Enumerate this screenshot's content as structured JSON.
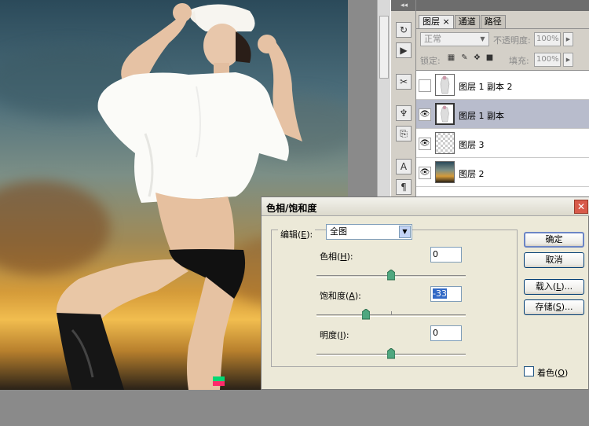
{
  "toolbar": {
    "collapse_label": "◂◂"
  },
  "layers_panel": {
    "tabs": [
      {
        "label": "图层",
        "close": "×",
        "active": true
      },
      {
        "label": "通道",
        "active": false
      },
      {
        "label": "路径",
        "active": false
      }
    ],
    "blend_mode": "正常",
    "opacity_label": "不透明度:",
    "opacity_value": "100%",
    "lock_label": "锁定:",
    "fill_label": "填充:",
    "fill_value": "100%",
    "layers": [
      {
        "name": "图层 1 副本 2",
        "visible": false,
        "selected": false,
        "thumb": "figure"
      },
      {
        "name": "图层 1 副本",
        "visible": true,
        "selected": true,
        "thumb": "figure"
      },
      {
        "name": "图层 3",
        "visible": true,
        "selected": false,
        "thumb": "checker"
      },
      {
        "name": "图层 2",
        "visible": true,
        "selected": false,
        "thumb": "sunset"
      }
    ]
  },
  "dialog": {
    "title": "色相/饱和度",
    "close_glyph": "✕",
    "edit_label": "编辑",
    "edit_hotkey": "E",
    "edit_value": "全图",
    "hue_label": "色相",
    "hue_hotkey": "H",
    "hue_value": "0",
    "saturation_label": "饱和度",
    "saturation_hotkey": "A",
    "saturation_value": "-33",
    "lightness_label": "明度",
    "lightness_hotkey": "I",
    "lightness_value": "0",
    "ok_label": "确定",
    "cancel_label": "取消",
    "load_label": "载入",
    "load_hotkey": "L",
    "save_label": "存储",
    "save_hotkey": "S",
    "colorize_label": "着色",
    "colorize_hotkey": "O",
    "colorize_checked": false
  },
  "colors": {
    "selected_layer": "#b8bccc",
    "dialog_bg": "#ece9d8",
    "close_button": "#d85a4a"
  }
}
